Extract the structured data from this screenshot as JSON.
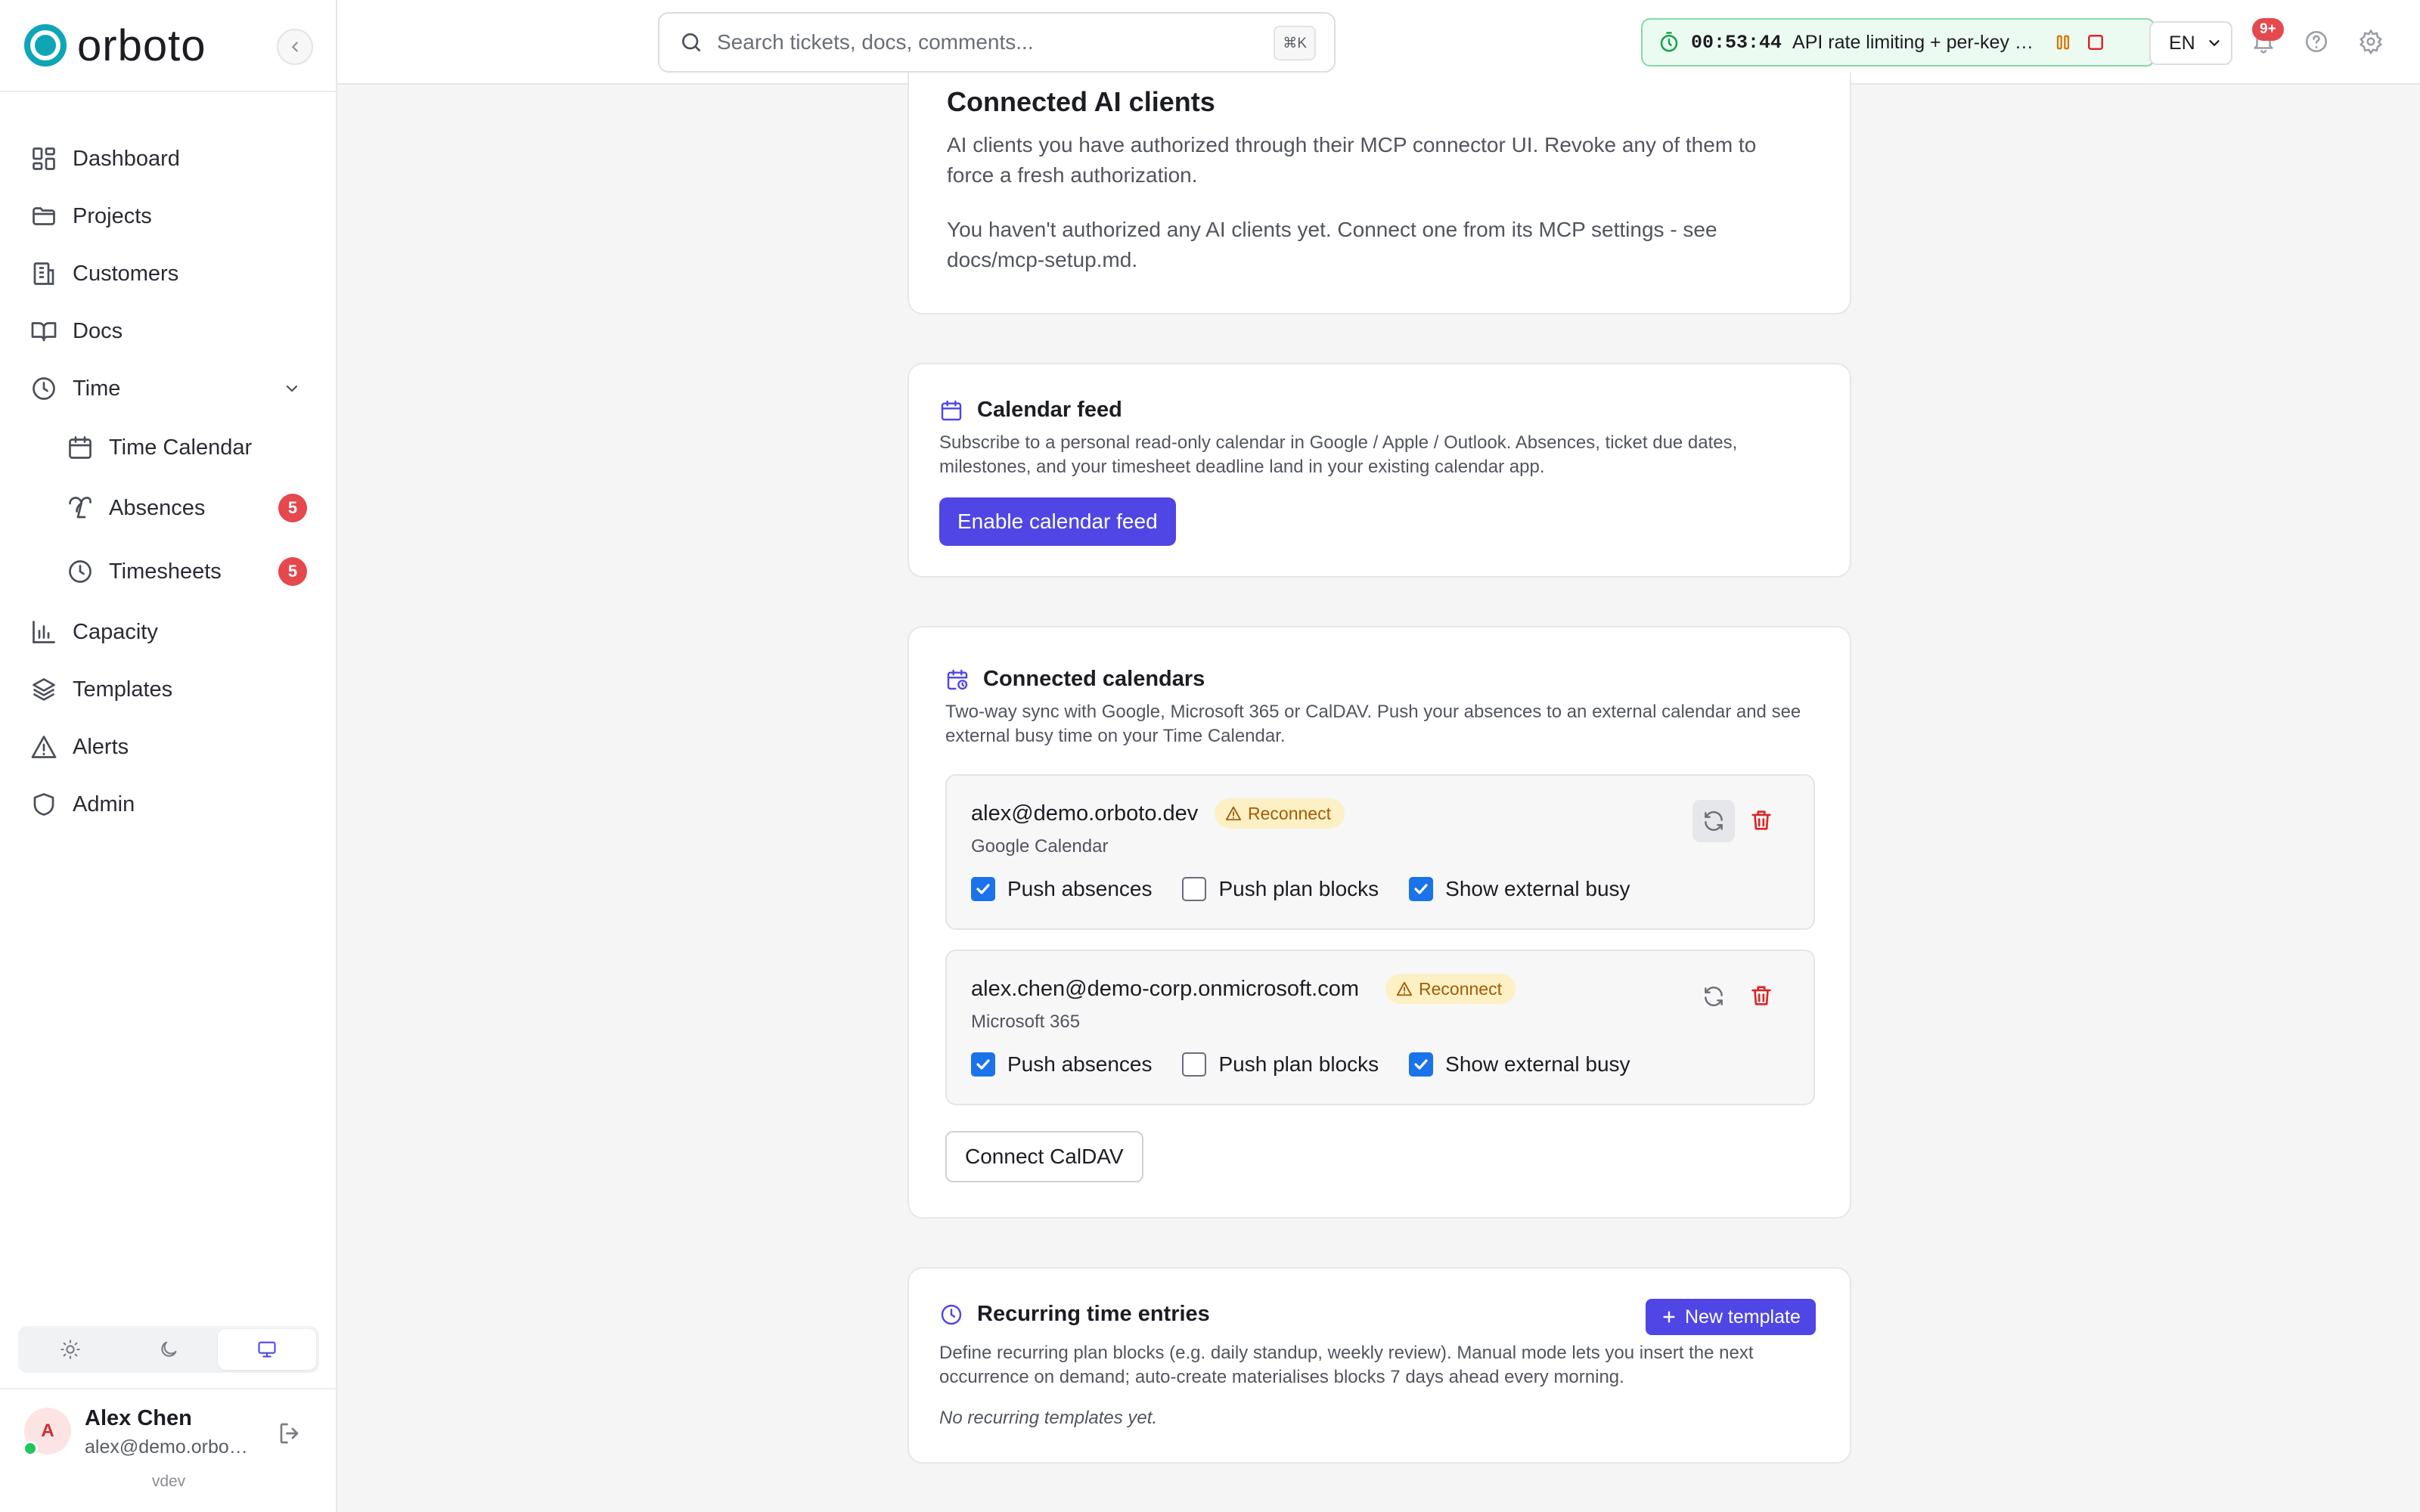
{
  "brand": {
    "name": "orboto",
    "accent": "#0ea5b7"
  },
  "sidebar": {
    "items": [
      {
        "label": "Dashboard",
        "icon": "dashboard-icon"
      },
      {
        "label": "Projects",
        "icon": "folder-icon"
      },
      {
        "label": "Customers",
        "icon": "building-icon"
      },
      {
        "label": "Docs",
        "icon": "book-icon"
      },
      {
        "label": "Time",
        "icon": "clock-icon",
        "expanded": true
      },
      {
        "label": "Time Calendar",
        "icon": "calendar-icon"
      },
      {
        "label": "Absences",
        "icon": "palm-tree-icon",
        "badge": "5"
      },
      {
        "label": "Timesheets",
        "icon": "clock-icon",
        "badge": "5"
      },
      {
        "label": "Capacity",
        "icon": "bar-chart-icon"
      },
      {
        "label": "Templates",
        "icon": "layers-icon"
      },
      {
        "label": "Alerts",
        "icon": "warning-icon"
      },
      {
        "label": "Admin",
        "icon": "shield-icon"
      }
    ],
    "theme_options": [
      "light",
      "dark",
      "system"
    ],
    "theme_selected": "system",
    "user": {
      "initial": "A",
      "name": "Alex Chen",
      "email": "alex@demo.orboto.dev"
    },
    "version": "vdev"
  },
  "topbar": {
    "search_placeholder": "Search tickets, docs, comments...",
    "search_shortcut": "⌘K",
    "timer": {
      "time": "00:53:44",
      "task": "API rate limiting + per-key quotas"
    },
    "language": "EN",
    "notification_count": "9+"
  },
  "ai_clients": {
    "title": "Connected AI clients",
    "description": "AI clients you have authorized through their MCP connector UI. Revoke any of them to force a fresh authorization.",
    "empty": "You haven't authorized any AI clients yet. Connect one from its MCP settings - see docs/mcp-setup.md."
  },
  "calendar_feed": {
    "title": "Calendar feed",
    "description": "Subscribe to a personal read-only calendar in Google / Apple / Outlook. Absences, ticket due dates, milestones, and your timesheet deadline land in your existing calendar app.",
    "button": "Enable calendar feed"
  },
  "connected_calendars": {
    "title": "Connected calendars",
    "description": "Two-way sync with Google, Microsoft 365 or CalDAV. Push your absences to an external calendar and see external busy time on your Time Calendar.",
    "connections": [
      {
        "email": "alex@demo.orboto.dev",
        "status": "Reconnect",
        "provider": "Google Calendar",
        "options": [
          {
            "label": "Push absences",
            "checked": true
          },
          {
            "label": "Push plan blocks",
            "checked": false
          },
          {
            "label": "Show external busy",
            "checked": true
          }
        ]
      },
      {
        "email": "alex.chen@demo-corp.onmicrosoft.com",
        "status": "Reconnect",
        "provider": "Microsoft 365",
        "options": [
          {
            "label": "Push absences",
            "checked": true
          },
          {
            "label": "Push plan blocks",
            "checked": false
          },
          {
            "label": "Show external busy",
            "checked": true
          }
        ]
      }
    ],
    "caldav_button": "Connect CalDAV"
  },
  "recurring": {
    "title": "Recurring time entries",
    "new_button": "New template",
    "description": "Define recurring plan blocks (e.g. daily standup, weekly review). Manual mode lets you insert the next occurrence on demand; auto-create materialises blocks 7 days ahead every morning.",
    "empty": "No recurring templates yet."
  },
  "colors": {
    "primary": "#4f46e5",
    "danger": "#dc2626",
    "warning_bg": "#fdf0c4",
    "checkbox": "#1a73e8"
  }
}
